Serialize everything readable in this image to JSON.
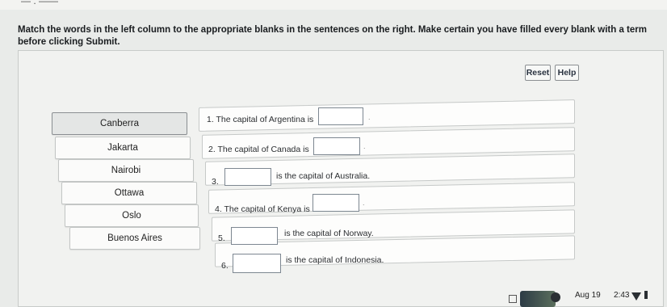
{
  "instructions": "Match the words in the left column to the appropriate blanks in the sentences on the right. Make certain you have filled every blank with a term before clicking Submit.",
  "buttons": {
    "reset": "Reset",
    "help": "Help"
  },
  "terms": [
    "Canberra",
    "Jakarta",
    "Nairobi",
    "Ottawa",
    "Oslo",
    "Buenos Aires"
  ],
  "sentences": [
    {
      "prefix": "1. The capital of Argentina is",
      "suffix": "."
    },
    {
      "prefix": "2. The capital of Canada is",
      "suffix": "."
    },
    {
      "prefix": "3.",
      "suffix": "is the capital of Australia."
    },
    {
      "prefix": "4. The capital of Kenya is",
      "suffix": "."
    },
    {
      "prefix": "5.",
      "suffix": "is the capital of Norway."
    },
    {
      "prefix": "6.",
      "suffix": "is the capital of Indonesia."
    }
  ],
  "status": {
    "date": "Aug 19",
    "time": "2:43"
  },
  "icons": [
    "app-icon",
    "status-dot-icon",
    "wifi-icon",
    "battery-icon"
  ]
}
